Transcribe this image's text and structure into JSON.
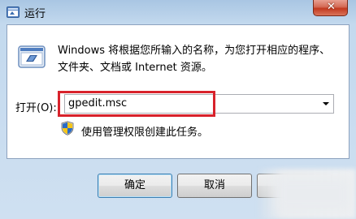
{
  "window": {
    "title": "运行",
    "close_glyph": "✕"
  },
  "description": {
    "line1": "Windows 将根据您所输入的名称，为您打开相应的程序、",
    "line2": "文件夹、文档或 Internet 资源。"
  },
  "open": {
    "label": "打开(O):",
    "value": "gpedit.msc"
  },
  "admin_note": "使用管理权限创建此任务。",
  "buttons": {
    "ok": "确定",
    "cancel": "取消",
    "browse": ""
  },
  "colors": {
    "highlight": "#d8222b",
    "close_button": "#c2391f",
    "frame": "#c3d9ee"
  }
}
